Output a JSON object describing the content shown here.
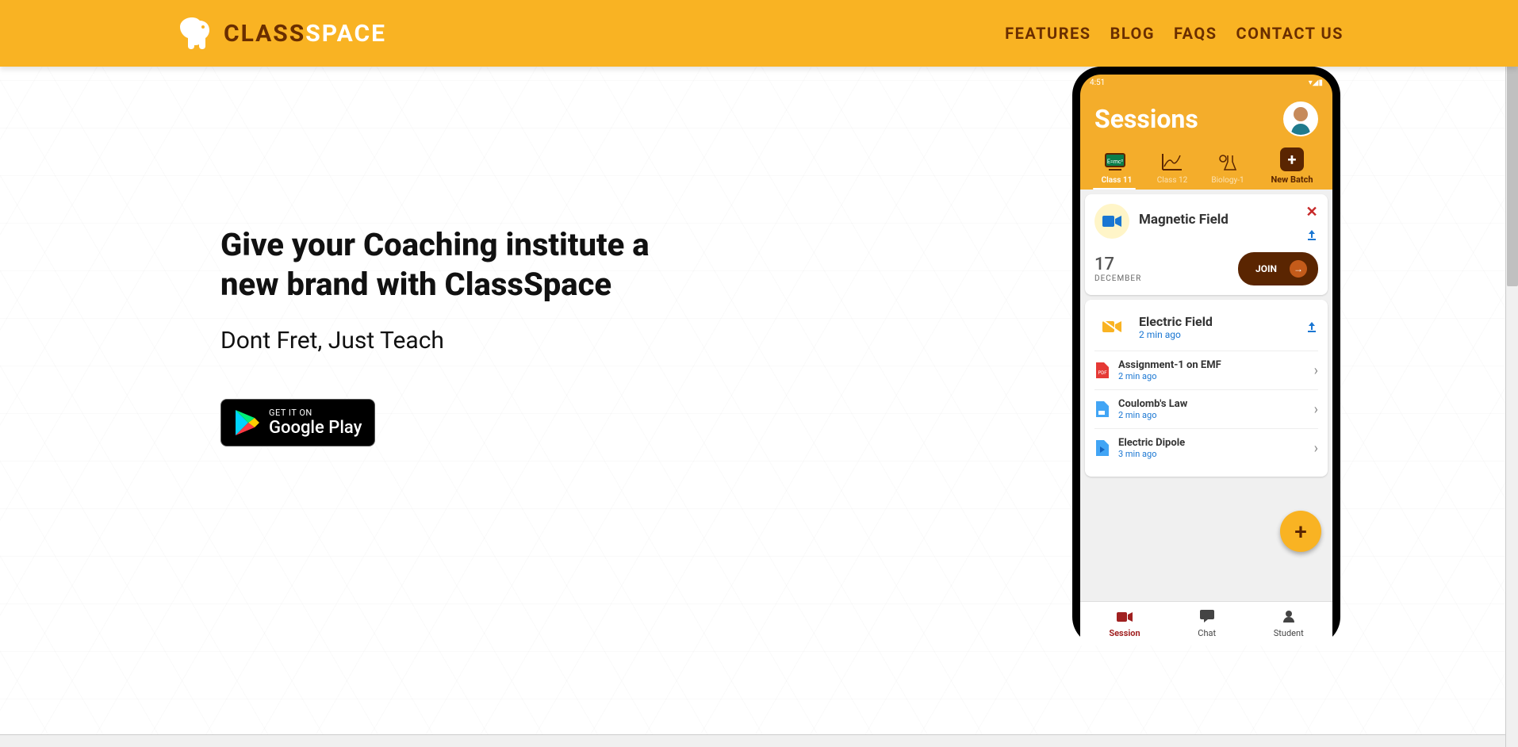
{
  "header": {
    "logo_class": "CLASS",
    "logo_space": "SPACE",
    "nav": [
      "FEATURES",
      "BLOG",
      "FAQS",
      "CONTACT US"
    ]
  },
  "hero": {
    "title": "Give your Coaching institute a new brand with ClassSpace",
    "subtitle": "Dont Fret, Just Teach",
    "gplay_small": "GET IT ON",
    "gplay_big": "Google Play"
  },
  "phone": {
    "status_time": "4:51",
    "app_title": "Sessions",
    "tabs": [
      {
        "label": "Class 11",
        "active": true
      },
      {
        "label": "Class 12",
        "active": false
      },
      {
        "label": "Biology-1",
        "active": false
      }
    ],
    "new_batch_label": "New Batch",
    "card1": {
      "title": "Magnetic Field",
      "day": "17",
      "month": "DECEMBER",
      "join_label": "JOIN"
    },
    "card2": {
      "title": "Electric Field",
      "ago": "2 min ago",
      "files": [
        {
          "title": "Assignment-1 on EMF",
          "ago": "2 min ago",
          "type": "pdf"
        },
        {
          "title": "Coulomb's Law",
          "ago": "2 min ago",
          "type": "doc"
        },
        {
          "title": "Electric Dipole",
          "ago": "3 min ago",
          "type": "play"
        }
      ]
    },
    "bottom_nav": [
      {
        "label": "Session",
        "active": true
      },
      {
        "label": "Chat",
        "active": false
      },
      {
        "label": "Student",
        "active": false
      }
    ]
  }
}
